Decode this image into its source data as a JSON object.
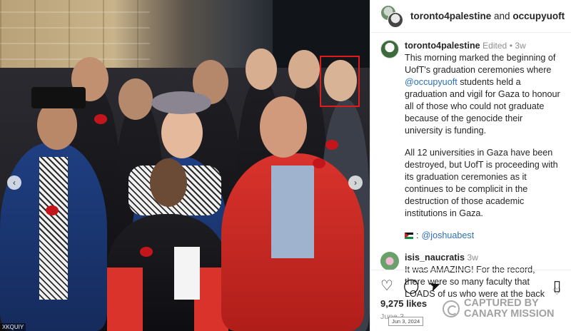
{
  "header": {
    "user1": "toronto4palestine",
    "joiner": "and",
    "user2": "occupyuoft"
  },
  "post": {
    "username": "toronto4palestine",
    "edited": "Edited",
    "dot": "•",
    "age": "3w",
    "text_a": "This morning marked the beginning of UofT's graduation ceremonies where ",
    "mention": "@occupyuoft",
    "text_b": " students held a graduation and vigil for Gaza to honour all of those who could not graduate because of the genocide their university is funding.",
    "paragraph2": "All 12 universities in Gaza have been destroyed, but UofT is proceeding with its graduation ceremonies as it continues to be complicit in the destruction of those academic institutions in Gaza.",
    "credit_icon": "palestine-flag-icon",
    "credit_prefix": ":",
    "credit_mention": "@joshuabest"
  },
  "comment": {
    "username": "isis_naucratis",
    "age": "3w",
    "text": "It was AMAZING! For the record, there were so many faculty that LOADS of us who were at the back"
  },
  "actions": {
    "like_icon": "♡",
    "comment_icon": "◯",
    "share_icon": "➤",
    "save_icon": "▯"
  },
  "likes": "9,275 likes",
  "date": "June 3",
  "date_tooltip": "Jun 3, 2024",
  "watermark": {
    "line1": "CAPTURED BY",
    "line2": "CANARY MISSION"
  },
  "photo": {
    "prev_arrow": "‹",
    "next_arrow": "›",
    "corner_tag": "XKQUIY"
  },
  "colors": {
    "mention": "#2e6fb5",
    "highlight": "#e01b1b"
  }
}
